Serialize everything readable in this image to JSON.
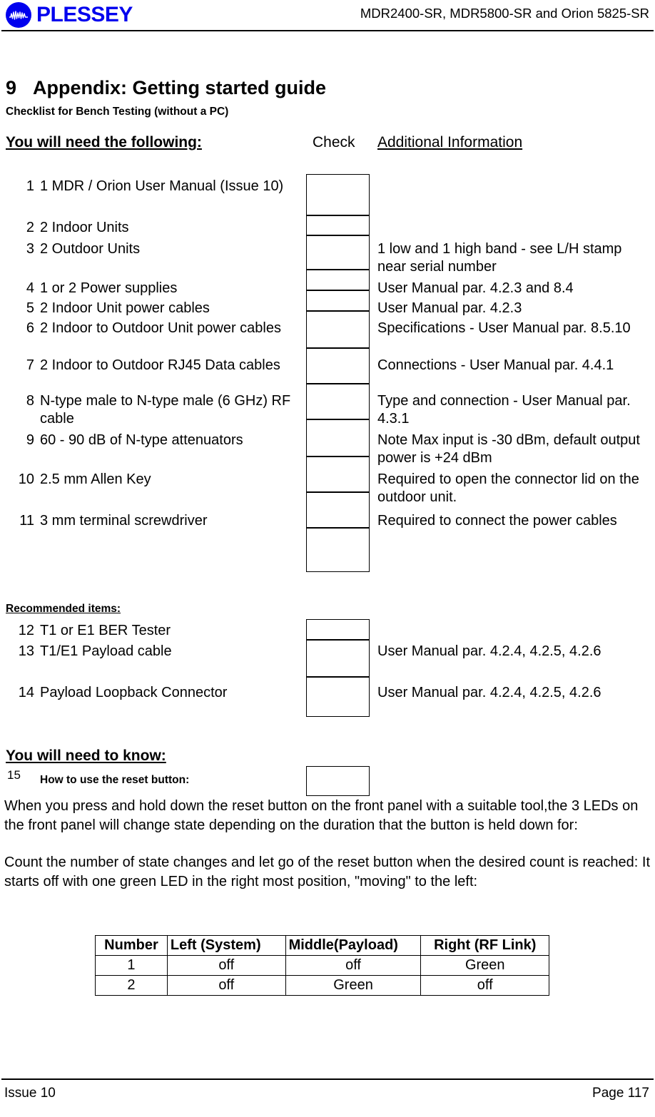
{
  "header": {
    "logo_text": "PLESSEY",
    "logo_icon": "plessey-waveform-circle-icon",
    "logo_color": "#0000EE",
    "title": "MDR2400-SR, MDR5800-SR and Orion 5825-SR"
  },
  "section": {
    "number": "9",
    "heading": "Appendix:  Getting started guide",
    "subheading": "Checklist for Bench Testing (without a PC)"
  },
  "columns": {
    "needed": "You will need the following:",
    "check": "Check",
    "additional": "Additional Information"
  },
  "required_items": [
    {
      "num": "1",
      "desc": "1 MDR / Orion User Manual (Issue 10)",
      "info": ""
    },
    {
      "num": "2",
      "desc": "2 Indoor Units",
      "info": ""
    },
    {
      "num": "3",
      "desc": "2 Outdoor Units",
      "info": "1 low and 1 high band - see L/H stamp near serial number"
    },
    {
      "num": "4",
      "desc": "1 or 2 Power supplies",
      "info": "User Manual par. 4.2.3 and 8.4"
    },
    {
      "num": "5",
      "desc": "2 Indoor Unit power cables",
      "info": "User Manual par. 4.2.3"
    },
    {
      "num": "6",
      "desc": "2 Indoor to Outdoor Unit power cables",
      "info": "Specifications - User Manual par. 8.5.10"
    },
    {
      "num": "7",
      "desc": "2 Indoor to Outdoor RJ45 Data cables",
      "info": "Connections - User Manual par. 4.4.1"
    },
    {
      "num": "8",
      "desc": "N-type male to N-type male (6 GHz) RF cable",
      "info": "Type and connection - User Manual par. 4.3.1"
    },
    {
      "num": "9",
      "desc": "60 - 90 dB of N-type attenuators",
      "info": "Note Max input is -30 dBm, default output power is +24 dBm"
    },
    {
      "num": "10",
      "desc": "2.5 mm Allen Key",
      "info": "Required to open the connector lid on the outdoor unit."
    },
    {
      "num": "11",
      "desc": "3 mm terminal screwdriver",
      "info": "Required to connect the power cables"
    }
  ],
  "recommended": {
    "heading": "Recommended items:",
    "items": [
      {
        "num": "12",
        "desc": "T1 or E1 BER Tester",
        "info": ""
      },
      {
        "num": "13",
        "desc": "T1/E1 Payload cable",
        "info": "User Manual par. 4.2.4, 4.2.5, 4.2.6"
      },
      {
        "num": "14",
        "desc": "Payload Loopback Connector",
        "info": "User Manual par. 4.2.4, 4.2.5, 4.2.6"
      }
    ]
  },
  "need_to_know": {
    "heading": "You will need to know:",
    "num": "15",
    "subheading": "How to use the reset button:",
    "para1": "When you press and hold down the reset button on the front panel with a suitable tool,the 3 LEDs on the front panel will change state depending on the duration that the button is held down for:",
    "para2": "Count the number of state changes and let go of the reset button when the desired count is reached:  It starts off with one green LED in the right most position, \"moving\" to the left:"
  },
  "led_table": {
    "headers": [
      "Number",
      "Left (System)",
      "Middle(Payload)",
      "Right (RF Link)"
    ],
    "rows": [
      [
        "1",
        "off",
        "off",
        "Green"
      ],
      [
        "2",
        "off",
        "Green",
        "off"
      ]
    ]
  },
  "footer": {
    "left": "Issue 10",
    "right": "Page 117"
  }
}
